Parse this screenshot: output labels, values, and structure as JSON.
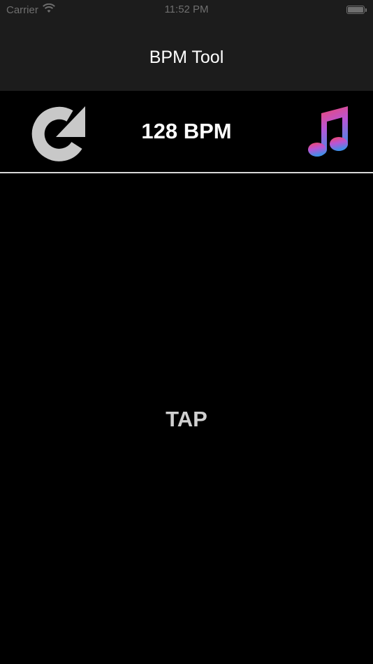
{
  "status_bar": {
    "carrier": "Carrier",
    "time": "11:52 PM",
    "icons": [
      "wifi-icon",
      "battery-icon"
    ]
  },
  "nav": {
    "title": "BPM Tool"
  },
  "toolbar": {
    "bpm_display": "128 BPM",
    "reset_icon": "refresh-icon",
    "music_icon": "music-note-icon"
  },
  "tap": {
    "label": "TAP"
  },
  "colors": {
    "background": "#000000",
    "bar_background": "#1c1c1c",
    "divider": "#d8d8d8",
    "reset_icon": "#c8c8c8",
    "music_gradient_top": "#f7455f",
    "music_gradient_bottom": "#3e8fe8"
  }
}
